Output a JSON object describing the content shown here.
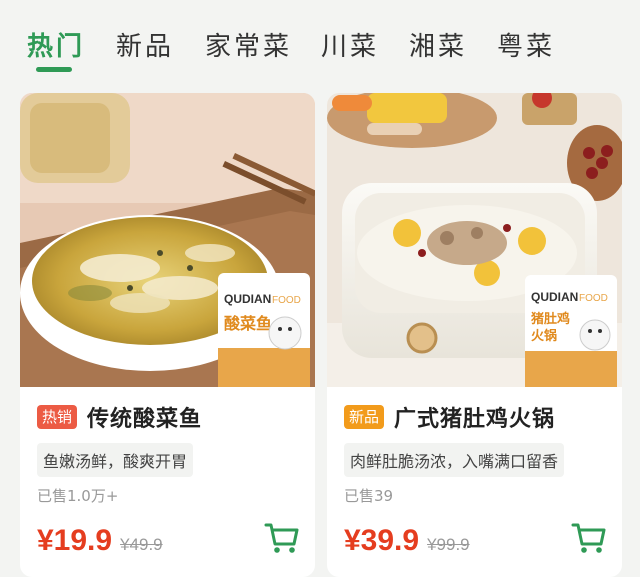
{
  "tabs": [
    {
      "label": "热门",
      "active": true
    },
    {
      "label": "新品",
      "active": false
    },
    {
      "label": "家常菜",
      "active": false
    },
    {
      "label": "川菜",
      "active": false
    },
    {
      "label": "湘菜",
      "active": false
    },
    {
      "label": "粤菜",
      "active": false
    }
  ],
  "colors": {
    "accent": "#2f9a56",
    "price": "#e53d1f",
    "hot_badge": "#ec5b44",
    "new_badge": "#f29b1b"
  },
  "products": [
    {
      "badge": "热销",
      "title": "传统酸菜鱼",
      "desc": "鱼嫩汤鲜，酸爽开胃",
      "sold": "已售1.0万+",
      "price": "¥19.9",
      "old_price": "¥49.9",
      "pack_brand": "QUDIAN",
      "pack_brand2": "FOOD",
      "pack_name": "酸菜鱼",
      "cart_icon": "cart-icon"
    },
    {
      "badge": "新品",
      "title": "广式猪肚鸡火锅",
      "desc": "肉鲜肚脆汤浓，入嘴满口留香",
      "sold": "已售39",
      "price": "¥39.9",
      "old_price": "¥99.9",
      "pack_brand": "QUDIAN",
      "pack_brand2": "FOOD",
      "pack_name": "猪肚鸡火锅",
      "cart_icon": "cart-icon"
    }
  ]
}
